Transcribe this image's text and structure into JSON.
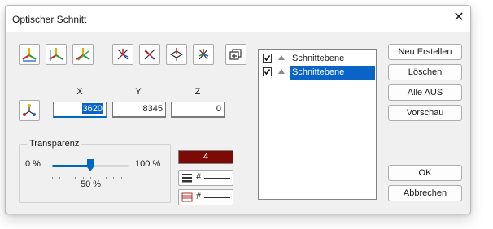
{
  "window": {
    "title": "Optischer Schnitt",
    "close_symbol": "✕"
  },
  "toolbar": {
    "icons": [
      "axes-xy-icon",
      "axes-yz-icon",
      "axes-xz-icon",
      "section-xy-icon",
      "section-yz-icon",
      "section-plane-icon",
      "section-rotate-icon",
      "section-box-icon"
    ]
  },
  "coords": {
    "x_label": "X",
    "y_label": "Y",
    "z_label": "Z",
    "x_value": "3620",
    "y_value": "8345",
    "z_value": "0"
  },
  "transparency": {
    "label": "Transparenz",
    "min_label": "0 %",
    "max_label": "100 %",
    "value_label": "50 %",
    "value_percent": 50
  },
  "style": {
    "color_index": "4",
    "color_hex": "#7c0a05",
    "line_type_symbol": "#",
    "hatch_symbol": "#"
  },
  "planes": {
    "items": [
      {
        "label": "Schnittebene",
        "checked": true,
        "selected": false
      },
      {
        "label": "Schnittebene",
        "checked": true,
        "selected": true
      }
    ]
  },
  "buttons": {
    "new": "Neu Erstellen",
    "delete": "Löschen",
    "all_off": "Alle AUS",
    "preview": "Vorschau",
    "ok": "OK",
    "cancel": "Abbrechen"
  },
  "colors": {
    "accent": "#0067c0",
    "selection": "#0a64c8"
  }
}
